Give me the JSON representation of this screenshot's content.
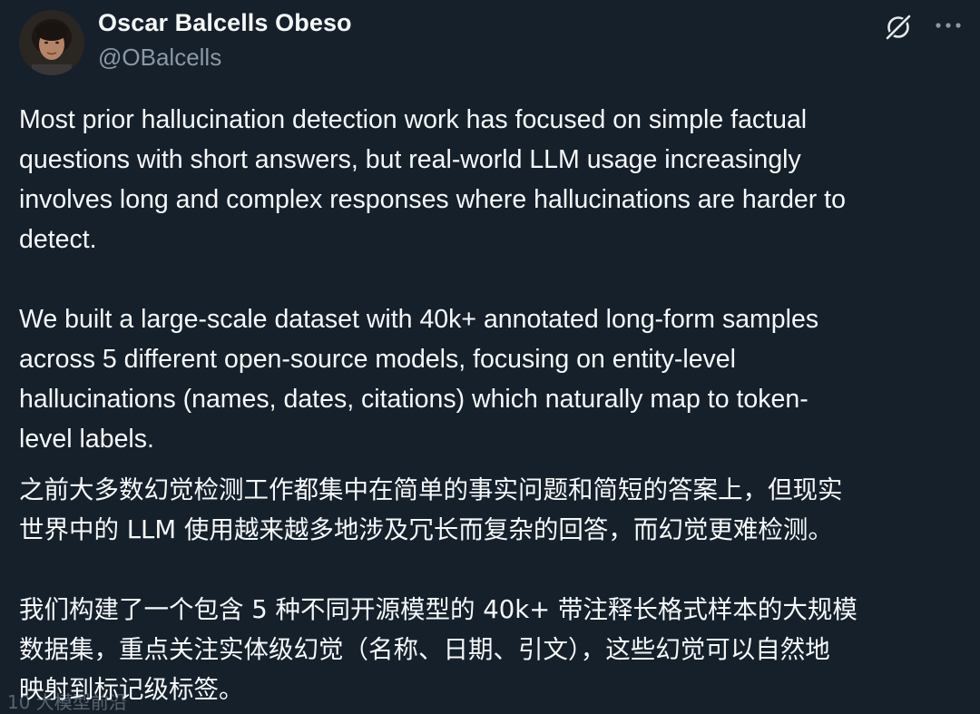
{
  "author": {
    "display_name": "Oscar Balcells Obeso",
    "handle": "@OBalcells"
  },
  "icons": {
    "grok": "grok-icon",
    "more": "more-horizontal-icon"
  },
  "colors": {
    "background": "#15202b",
    "text_primary": "#f7f9f9",
    "text_secondary": "#8b98a5"
  },
  "tweet": {
    "paragraph_en_1": "Most prior hallucination detection work has focused on simple factual\nquestions with short answers, but real-world LLM usage increasingly\ninvolves long and complex responses where hallucinations are harder to\ndetect.",
    "paragraph_en_2": "We built a large-scale dataset with 40k+ annotated long-form samples\nacross 5 different open-source models, focusing on entity-level\nhallucinations (names, dates, citations) which naturally map to token-\nlevel labels.",
    "paragraph_zh_1": "之前大多数幻觉检测工作都集中在简单的事实问题和简短的答案上，但现实\n世界中的 LLM 使用越来越多地涉及冗长而复杂的回答，而幻觉更难检测。",
    "paragraph_zh_2": "我们构建了一个包含 5 种不同开源模型的 40k+ 带注释长格式样本的大规模\n数据集，重点关注实体级幻觉（名称、日期、引文），这些幻觉可以自然地\n映射到标记级标签。"
  },
  "watermark": "10 大模型前沿"
}
